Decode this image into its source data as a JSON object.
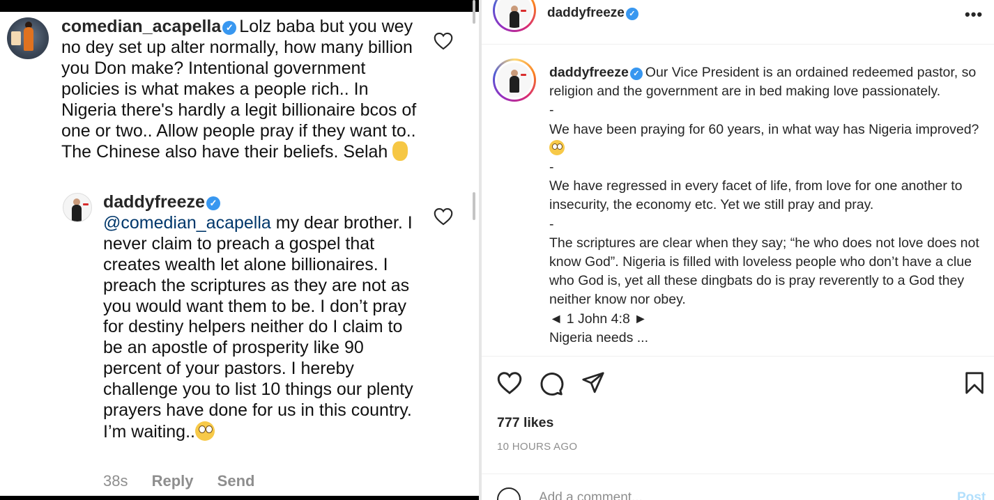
{
  "left": {
    "comment": {
      "username": "comedian_acapella",
      "verified_mark": "✓",
      "text": "Lolz baba but you wey no dey set up alter normally, how many billion you Don make?  Intentional government policies is what makes a people rich.. In Nigeria there's hardly a legit billionaire bcos of one or two.. Allow people pray if they want to.. The Chinese also have their beliefs. Selah",
      "avatar_icon": "profile-photo",
      "like_icon": "heart-outline-icon"
    },
    "reply": {
      "username": "daddyfreeze",
      "verified_mark": "✓",
      "mention": "@comedian_acapella",
      "text": " my dear brother. I never claim to preach a gospel that creates wealth let alone billionaires. I preach the scriptures as they are not as you would want them to be. I don’t pray for destiny helpers neither do I claim to be an apostle of prosperity like 90 percent of your pastors. I hereby challenge you to list 10 things our plenty prayers have done for us in this country. I’m waiting..",
      "time": "38s",
      "reply_label": "Reply",
      "send_label": "Send"
    }
  },
  "right": {
    "header": {
      "username": "daddyfreeze",
      "verified_mark": "✓",
      "more_label": "•••"
    },
    "caption": {
      "username": "daddyfreeze",
      "verified_mark": "✓",
      "p1": "Our Vice President is an ordained redeemed pastor, so religion and the government are in bed making love passionately.",
      "d1": "-",
      "p2": "We have been praying for 60 years, in what way has Nigeria improved?",
      "d2": "-",
      "p3": "We have regressed in every facet of life, from love for one another to insecurity, the economy etc. Yet we still pray and pray.",
      "d3": "-",
      "p4": "The scriptures are clear when they say; “he who does not love does not know God”. Nigeria is filled with loveless people who don’t have a clue who God is, yet all these dingbats do is pray reverently to a God they neither know nor obey.",
      "verse": "◄ 1 John 4:8 ►",
      "cut_line": "Nigeria needs ..."
    },
    "likes": "777 likes",
    "time_ago": "10 HOURS AGO",
    "add_comment_placeholder": "Add a comment...",
    "post_label": "Post",
    "icons": [
      "heart-icon",
      "comment-icon",
      "share-icon",
      "bookmark-icon",
      "emoji-icon"
    ],
    "colors": {
      "verified": "#3897f0",
      "mention": "#00376b",
      "muted": "#8e8e8e",
      "post_disabled": "#b2dffc"
    }
  }
}
